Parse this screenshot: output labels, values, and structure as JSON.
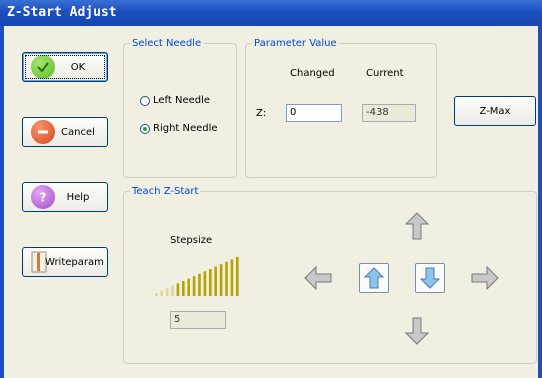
{
  "window": {
    "title": "Z-Start Adjust"
  },
  "buttons": {
    "ok": {
      "label": "OK",
      "icon": "check-icon"
    },
    "cancel": {
      "label": "Cancel",
      "icon": "minus-icon"
    },
    "help": {
      "label": "Help",
      "icon": "question-icon"
    },
    "writeparam": {
      "label": "Writeparam",
      "icon": "write-icon"
    },
    "zmax": {
      "label": "Z-Max"
    }
  },
  "select_needle": {
    "legend": "Select Needle",
    "options": [
      {
        "label": "Left Needle",
        "selected": false
      },
      {
        "label": "Right Needle",
        "selected": true
      }
    ]
  },
  "parameter_value": {
    "legend": "Parameter Value",
    "col_changed": "Changed",
    "col_current": "Current",
    "row_label": "Z:",
    "changed_value": "0",
    "current_value": "-438"
  },
  "teach": {
    "legend": "Teach Z-Start",
    "stepsize_label": "Stepsize",
    "stepsize_value": "5",
    "arrows": [
      "arrow-up-large-icon",
      "arrow-left-icon",
      "arrow-up-small-icon",
      "arrow-down-small-icon",
      "arrow-right-icon",
      "arrow-down-large-icon"
    ]
  },
  "colors": {
    "title_bar": "#1c4fbf",
    "group_legend": "#0046d5",
    "ok_icon": "#5cbf2a",
    "cancel_icon": "#d8441c",
    "help_icon": "#a24cc6",
    "stepsize_bar": "#b5a400"
  }
}
